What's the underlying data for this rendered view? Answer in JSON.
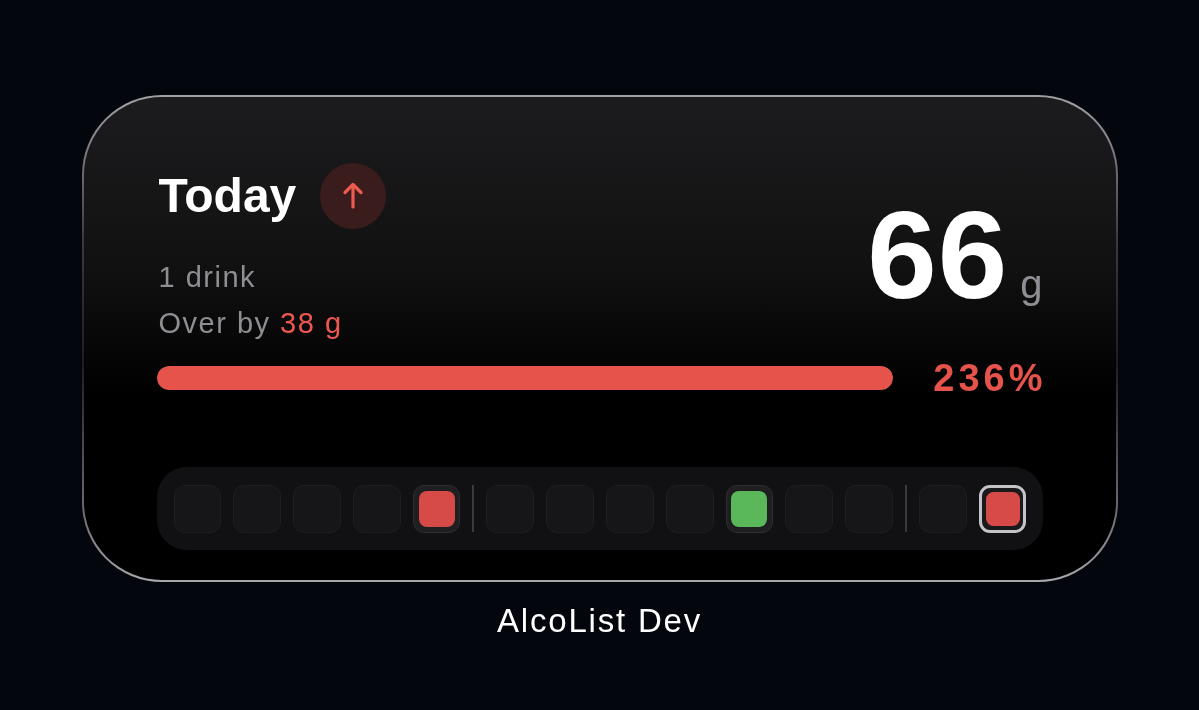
{
  "widget": {
    "title": "Today",
    "over_limit": true,
    "drinks": "1 drink",
    "status": {
      "label": "Over by",
      "amount": "38 g"
    },
    "total": {
      "value": "66",
      "unit": "g"
    },
    "progress": {
      "level": 1,
      "reading": "236%"
    },
    "day_groups": [
      {
        "days": [
          {
            "selected": false
          },
          {
            "selected": false
          },
          {
            "selected": false
          },
          {
            "selected": false
          },
          {
            "selected": false,
            "color": "#d64b47"
          }
        ]
      },
      {
        "days": [
          {
            "selected": false
          },
          {
            "selected": false
          },
          {
            "selected": false
          },
          {
            "selected": false
          },
          {
            "selected": false,
            "color": "#5bb85a"
          },
          {
            "selected": false
          },
          {
            "selected": false
          }
        ]
      },
      {
        "days": [
          {
            "selected": false
          },
          {
            "selected": true,
            "color": "#d64b47"
          }
        ]
      }
    ]
  },
  "caption": "AlcoList Dev"
}
